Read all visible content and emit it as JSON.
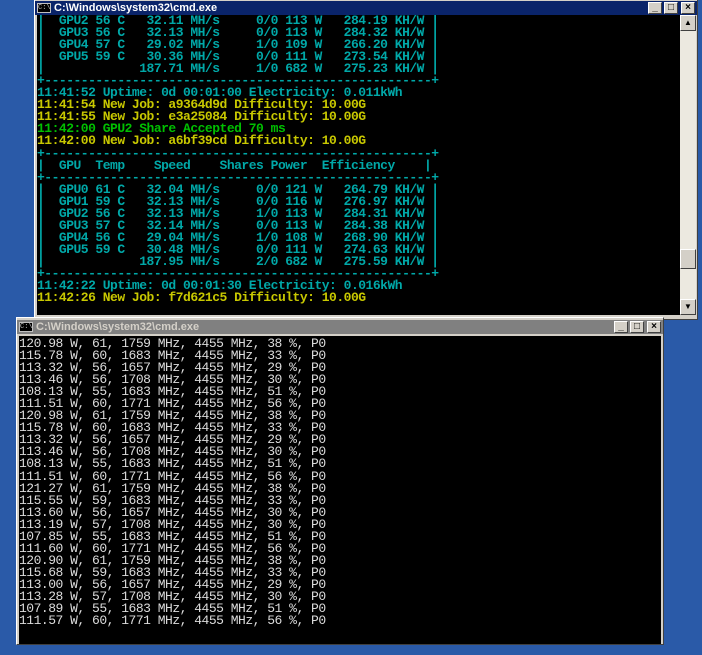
{
  "window1": {
    "title": "C:\\Windows\\system32\\cmd.exe",
    "lines": [
      {
        "text": "|  GPU2 56 C   32.11 MH/s     0/0 113 W   284.19 KH/W |",
        "color": "#00a8a8"
      },
      {
        "text": "|  GPU3 56 C   32.13 MH/s     0/0 113 W   284.32 KH/W |",
        "color": "#00a8a8"
      },
      {
        "text": "|  GPU4 57 C   29.02 MH/s     1/0 109 W   266.20 KH/W |",
        "color": "#00a8a8"
      },
      {
        "text": "|  GPU5 59 C   30.36 MH/s     0/0 111 W   273.54 KH/W |",
        "color": "#00a8a8"
      },
      {
        "text": "|             187.71 MH/s     1/0 682 W   275.23 KH/W |",
        "color": "#00a8a8"
      },
      {
        "text": "+-----------------------------------------------------+",
        "color": "#00a8a8"
      },
      {
        "text": "11:41:52 Uptime: 0d 00:01:00 Electricity: 0.011kWh",
        "color": "#00a8a8"
      },
      {
        "text": "11:41:54 New Job: a9364d9d Difficulty: 10.00G",
        "color": "#c8c800"
      },
      {
        "text": "11:41:55 New Job: e3a25084 Difficulty: 10.00G",
        "color": "#c8c800"
      },
      {
        "text": "11:42:00 GPU2 Share Accepted 70 ms",
        "color": "#00c000"
      },
      {
        "text": "11:42:00 New Job: a6bf39cd Difficulty: 10.00G",
        "color": "#c8c800"
      },
      {
        "text": "+-----------------------------------------------------+",
        "color": "#00a8a8"
      },
      {
        "text": "|  GPU  Temp    Speed    Shares Power  Efficiency    |",
        "color": "#00a8a8"
      },
      {
        "text": "+-----------------------------------------------------+",
        "color": "#00a8a8"
      },
      {
        "text": "|  GPU0 61 C   32.04 MH/s     0/0 121 W   264.79 KH/W |",
        "color": "#00a8a8"
      },
      {
        "text": "|  GPU1 59 C   32.13 MH/s     0/0 116 W   276.97 KH/W |",
        "color": "#00a8a8"
      },
      {
        "text": "|  GPU2 56 C   32.13 MH/s     1/0 113 W   284.31 KH/W |",
        "color": "#00a8a8"
      },
      {
        "text": "|  GPU3 57 C   32.14 MH/s     0/0 113 W   284.38 KH/W |",
        "color": "#00a8a8"
      },
      {
        "text": "|  GPU4 56 C   29.04 MH/s     1/0 108 W   268.90 KH/W |",
        "color": "#00a8a8"
      },
      {
        "text": "|  GPU5 59 C   30.48 MH/s     0/0 111 W   274.63 KH/W |",
        "color": "#00a8a8"
      },
      {
        "text": "|             187.95 MH/s     2/0 682 W   275.59 KH/W |",
        "color": "#00a8a8"
      },
      {
        "text": "+-----------------------------------------------------+",
        "color": "#00a8a8"
      },
      {
        "text": "11:42:22 Uptime: 0d 00:01:30 Electricity: 0.016kWh",
        "color": "#00a8a8"
      },
      {
        "text": "11:42:26 New Job: f7d621c5 Difficulty: 10.00G",
        "color": "#c8c800"
      }
    ]
  },
  "window2": {
    "title": "C:\\Windows\\system32\\cmd.exe",
    "lines": [
      "120.98 W, 61, 1759 MHz, 4455 MHz, 38 %, P0",
      "115.78 W, 60, 1683 MHz, 4455 MHz, 33 %, P0",
      "113.32 W, 56, 1657 MHz, 4455 MHz, 29 %, P0",
      "113.46 W, 56, 1708 MHz, 4455 MHz, 30 %, P0",
      "108.13 W, 55, 1683 MHz, 4455 MHz, 51 %, P0",
      "111.51 W, 60, 1771 MHz, 4455 MHz, 56 %, P0",
      "120.98 W, 61, 1759 MHz, 4455 MHz, 38 %, P0",
      "115.78 W, 60, 1683 MHz, 4455 MHz, 33 %, P0",
      "113.32 W, 56, 1657 MHz, 4455 MHz, 29 %, P0",
      "113.46 W, 56, 1708 MHz, 4455 MHz, 30 %, P0",
      "108.13 W, 55, 1683 MHz, 4455 MHz, 51 %, P0",
      "111.51 W, 60, 1771 MHz, 4455 MHz, 56 %, P0",
      "121.27 W, 61, 1759 MHz, 4455 MHz, 38 %, P0",
      "115.55 W, 59, 1683 MHz, 4455 MHz, 33 %, P0",
      "113.60 W, 56, 1657 MHz, 4455 MHz, 30 %, P0",
      "113.19 W, 57, 1708 MHz, 4455 MHz, 30 %, P0",
      "107.85 W, 55, 1683 MHz, 4455 MHz, 51 %, P0",
      "111.60 W, 60, 1771 MHz, 4455 MHz, 56 %, P0",
      "120.90 W, 61, 1759 MHz, 4455 MHz, 38 %, P0",
      "115.68 W, 59, 1683 MHz, 4455 MHz, 33 %, P0",
      "113.00 W, 56, 1657 MHz, 4455 MHz, 29 %, P0",
      "113.28 W, 57, 1708 MHz, 4455 MHz, 30 %, P0",
      "107.89 W, 55, 1683 MHz, 4455 MHz, 51 %, P0",
      "111.57 W, 60, 1771 MHz, 4455 MHz, 56 %, P0"
    ]
  },
  "controls": {
    "icon": "C:\\",
    "minimize": "_",
    "maximize": "□",
    "close": "×",
    "scroll_up": "▲",
    "scroll_down": "▼"
  },
  "icons": [
    "cmd-icon",
    "minimize-icon",
    "maximize-icon",
    "close-icon",
    "scroll-up-icon",
    "scroll-down-icon"
  ],
  "colors": {
    "desktop": "#2a5aa8",
    "cyan": "#00a8a8",
    "yellow": "#c8c800",
    "green": "#00c000",
    "white": "#dcdcdc",
    "active_title": "#0a246a",
    "inactive_title": "#808080"
  },
  "scroll": {
    "position": 0.88
  }
}
